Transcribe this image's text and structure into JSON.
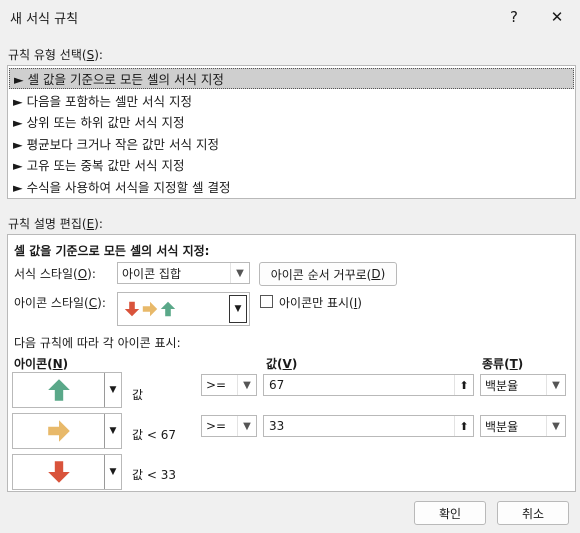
{
  "window": {
    "title": "새 서식 규칙",
    "help": "?",
    "close": "✕"
  },
  "rule_type": {
    "label_prefix": "규칙 유형 선택(",
    "label_key": "S",
    "label_suffix": "):",
    "items": [
      "► 셀 값을 기준으로 모든 셀의 서식 지정",
      "► 다음을 포함하는 셀만 서식 지정",
      "► 상위 또는 하위 값만 서식 지정",
      "► 평균보다 크거나 작은 값만 서식 지정",
      "► 고유 또는 중복 값만 서식 지정",
      "► 수식을 사용하여 서식을 지정할 셀 결정"
    ]
  },
  "edit": {
    "label_prefix": "규칙 설명 편집(",
    "label_key": "E",
    "label_suffix": "):",
    "heading": "셀 값을 기준으로 모든 셀의 서식 지정:",
    "format_style": {
      "label_prefix": "서식 스타일(",
      "label_key": "O",
      "label_suffix": "):",
      "value": "아이콘 집합"
    },
    "reverse_button": {
      "prefix": "아이콘 순서 거꾸로(",
      "key": "D",
      "suffix": ")"
    },
    "icon_style": {
      "label_prefix": "아이콘 스타일(",
      "label_key": "C",
      "label_suffix": "):"
    },
    "icon_only": {
      "prefix": "아이콘만 표시(",
      "key": "I",
      "suffix": ")"
    },
    "rules_caption": "다음 규칙에 따라 각 아이콘 표시:",
    "col_icon": {
      "prefix": "아이콘(",
      "key": "N",
      "suffix": ")"
    },
    "col_value": {
      "prefix": "값(",
      "key": "V",
      "suffix": ")"
    },
    "col_type": {
      "prefix": "종류(",
      "key": "T",
      "suffix": ")"
    },
    "rows": [
      {
        "condition": "값",
        "operator": ">=",
        "value": "67",
        "type": "백분율"
      },
      {
        "condition": "값 < 67",
        "operator": ">=",
        "value": "33",
        "type": "백분율"
      },
      {
        "condition": "값 < 33"
      }
    ]
  },
  "buttons": {
    "ok": "확인",
    "cancel": "취소"
  },
  "colors": {
    "up": "#5aa889",
    "side": "#e8b96a",
    "down": "#d9533b"
  }
}
